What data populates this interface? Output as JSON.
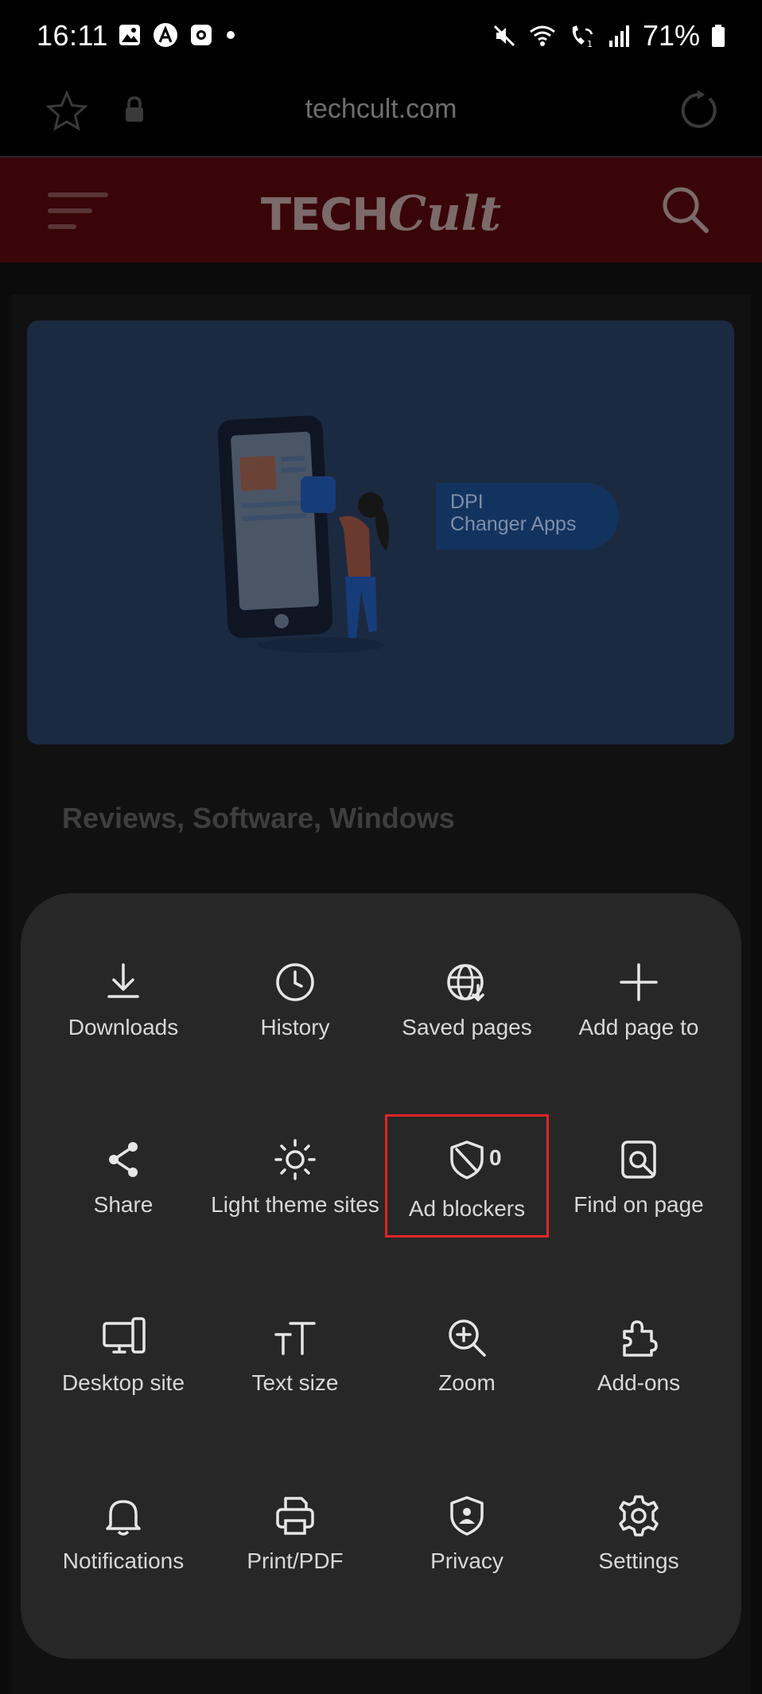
{
  "status_bar": {
    "time": "16:11",
    "battery": "71%",
    "icons": [
      "gallery-icon",
      "a-app-icon",
      "camera-app-icon",
      "dot-icon",
      "mute-icon",
      "wifi-icon",
      "wifi-calling-icon",
      "signal-icon",
      "battery-icon"
    ]
  },
  "browser": {
    "url": "techcult.com",
    "icons": [
      "bookmark-star-icon",
      "lock-icon",
      "reload-icon"
    ]
  },
  "site": {
    "logo_part1": "TECH",
    "logo_part2": "Cult",
    "hero_badge_line1": "DPI",
    "hero_badge_line2": "Changer Apps",
    "categories": "Reviews, Software, Windows"
  },
  "menu": {
    "items": [
      {
        "label": "Downloads",
        "icon": "download-icon"
      },
      {
        "label": "History",
        "icon": "clock-icon"
      },
      {
        "label": "Saved pages",
        "icon": "globe-download-icon"
      },
      {
        "label": "Add page to",
        "icon": "plus-icon"
      },
      {
        "label": "Share",
        "icon": "share-icon"
      },
      {
        "label": "Light theme sites",
        "icon": "sun-icon"
      },
      {
        "label": "Ad blockers",
        "icon": "shield-slash-icon",
        "count": "0"
      },
      {
        "label": "Find on page",
        "icon": "find-page-icon"
      },
      {
        "label": "Desktop site",
        "icon": "desktop-icon"
      },
      {
        "label": "Text size",
        "icon": "text-size-icon"
      },
      {
        "label": "Zoom",
        "icon": "zoom-in-icon"
      },
      {
        "label": "Add-ons",
        "icon": "puzzle-icon"
      },
      {
        "label": "Notifications",
        "icon": "bell-icon"
      },
      {
        "label": "Print/PDF",
        "icon": "printer-icon"
      },
      {
        "label": "Privacy",
        "icon": "privacy-shield-icon"
      },
      {
        "label": "Settings",
        "icon": "gear-icon"
      }
    ]
  },
  "colors": {
    "highlight": "#e0242a",
    "sheet_bg": "#272727",
    "header_bg": "#3a0508"
  }
}
